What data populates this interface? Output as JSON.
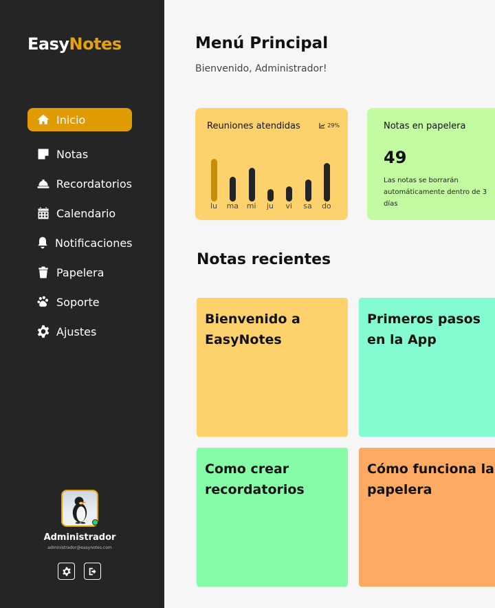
{
  "brand": {
    "part1": "Easy",
    "part2": "Notes"
  },
  "sidebar": {
    "items": [
      {
        "label": "Inicio",
        "icon": "home-icon",
        "active": true
      },
      {
        "label": "Notas",
        "icon": "note-icon"
      },
      {
        "label": "Recordatorios",
        "icon": "bell-service-icon"
      },
      {
        "label": "Calendario",
        "icon": "calendar-icon"
      },
      {
        "label": "Notificaciones",
        "icon": "bell-icon"
      },
      {
        "label": "Papelera",
        "icon": "trash-icon"
      },
      {
        "label": "Soporte",
        "icon": "paw-icon"
      },
      {
        "label": "Ajustes",
        "icon": "gear-icon"
      }
    ]
  },
  "profile": {
    "name": "Administrador",
    "email": "administrador@easynotes.com",
    "status_color": "#2bd55b"
  },
  "header": {
    "title": "Menú Principal",
    "subtitle": "Bienvenido, Administrador!"
  },
  "meetings": {
    "title": "Reuniones atendidas",
    "trend": "29%",
    "chart_data": {
      "type": "bar",
      "categories": [
        "lu",
        "ma",
        "mi",
        "ju",
        "vi",
        "sa",
        "do"
      ],
      "values": [
        0.82,
        0.48,
        0.65,
        0.24,
        0.29,
        0.42,
        0.74
      ],
      "highlight_index": 0
    }
  },
  "trash": {
    "title": "Notas en papelera",
    "count": "49",
    "note": "Las notas se borrarán automáticamente dentro de 3 días"
  },
  "recent": {
    "title": "Notas recientes",
    "notes": [
      {
        "title": "Bienvenido a EasyNotes",
        "color": "#fdd26c"
      },
      {
        "title": "Primeros pasos en la App",
        "color": "#84fcd0"
      },
      {
        "title": "Como crear recordatorios",
        "color": "#86fca8"
      },
      {
        "title": "Cómo funciona la papelera",
        "color": "#fdab64"
      }
    ]
  },
  "colors": {
    "accent": "#e09a04",
    "sidebar_bg": "#252525"
  }
}
